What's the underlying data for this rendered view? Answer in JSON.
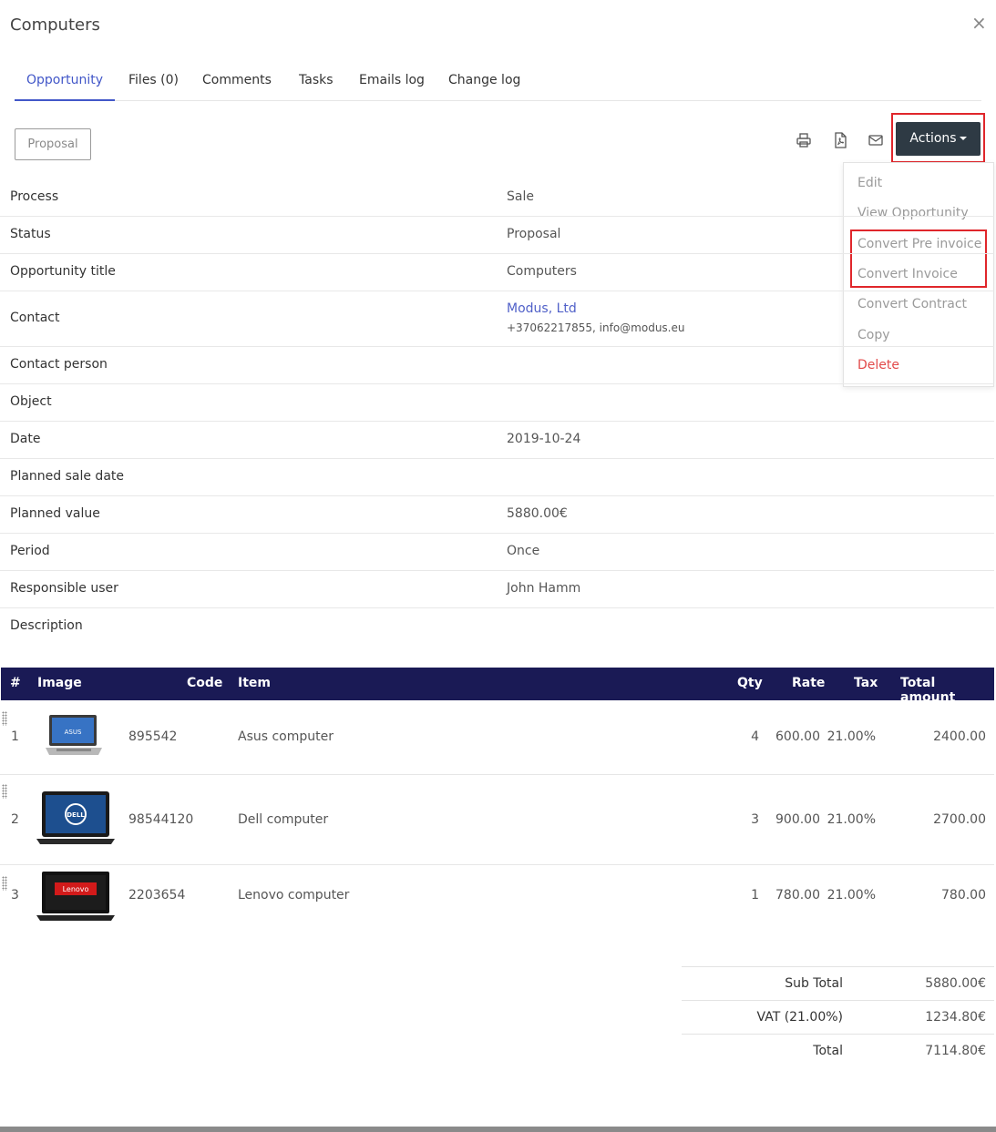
{
  "modal": {
    "title": "Computers",
    "close_symbol": "×"
  },
  "tabs": [
    {
      "label": "Opportunity",
      "active": true
    },
    {
      "label": "Files (0)"
    },
    {
      "label": "Comments"
    },
    {
      "label": "Tasks"
    },
    {
      "label": "Emails log"
    },
    {
      "label": "Change log"
    }
  ],
  "toolbar": {
    "stage_label": "Proposal",
    "icons": [
      "print-icon",
      "pdf-icon",
      "email-icon"
    ],
    "actions_label": "Actions"
  },
  "actions_menu": [
    {
      "label": "Edit"
    },
    {
      "label": "View Opportunity"
    },
    {
      "label": "Convert Pre invoice"
    },
    {
      "label": "Convert Invoice"
    },
    {
      "label": "Convert Contract"
    },
    {
      "label": "Copy"
    },
    {
      "label": "Delete",
      "danger": true
    }
  ],
  "details": {
    "process": {
      "label": "Process",
      "value": "Sale"
    },
    "status": {
      "label": "Status",
      "value": "Proposal"
    },
    "title": {
      "label": "Opportunity title",
      "value": "Computers"
    },
    "contact": {
      "label": "Contact",
      "value": "Modus, Ltd",
      "sub": "+37062217855, info@modus.eu"
    },
    "contact_person": {
      "label": "Contact person",
      "value": ""
    },
    "object": {
      "label": "Object",
      "value": ""
    },
    "date": {
      "label": "Date",
      "value": "2019-10-24"
    },
    "planned_sale_date": {
      "label": "Planned sale date",
      "value": ""
    },
    "planned_value": {
      "label": "Planned value",
      "value": "5880.00€"
    },
    "period": {
      "label": "Period",
      "value": "Once"
    },
    "responsible_user": {
      "label": "Responsible user",
      "value": "John Hamm"
    },
    "description": {
      "label": "Description",
      "value": ""
    }
  },
  "items_table": {
    "headers": {
      "num": "#",
      "image": "Image",
      "code": "Code",
      "item": "Item",
      "qty": "Qty",
      "rate": "Rate",
      "tax": "Tax",
      "total": "Total amount"
    },
    "rows": [
      {
        "num": "1",
        "code": "895542",
        "item": "Asus computer",
        "qty": "4",
        "rate": "600.00",
        "tax": "21.00%",
        "total": "2400.00",
        "brand": "ASUS"
      },
      {
        "num": "2",
        "code": "98544120",
        "item": "Dell computer",
        "qty": "3",
        "rate": "900.00",
        "tax": "21.00%",
        "total": "2700.00",
        "brand": "DELL"
      },
      {
        "num": "3",
        "code": "2203654",
        "item": "Lenovo computer",
        "qty": "1",
        "rate": "780.00",
        "tax": "21.00%",
        "total": "780.00",
        "brand": "Lenovo"
      }
    ]
  },
  "totals": {
    "subtotal": {
      "label": "Sub Total",
      "value": "5880.00€"
    },
    "vat": {
      "label": "VAT (21.00%)",
      "value": "1234.80€"
    },
    "total": {
      "label": "Total",
      "value": "7114.80€"
    }
  },
  "colors": {
    "accent": "#4257c8",
    "table_header": "#1a1a55",
    "actions_button": "#2e3a44",
    "highlight": "#e0262b",
    "danger": "#e24a4a"
  }
}
